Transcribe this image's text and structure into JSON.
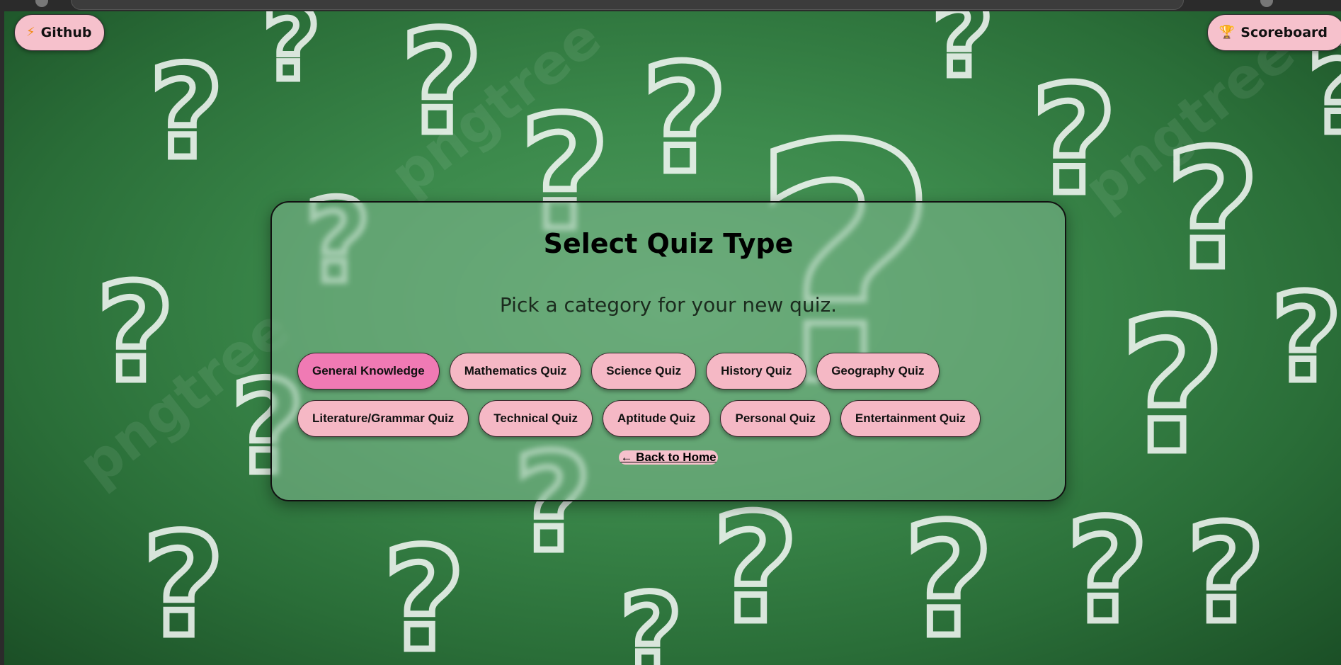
{
  "header": {
    "github_label": "Github",
    "github_icon": "lightning-icon",
    "scoreboard_label": "Scoreboard",
    "scoreboard_icon": "trophy-icon"
  },
  "background": {
    "watermark_text": "pngtree",
    "chalk_color": "#ffffff",
    "board_color": "#3c8a4c"
  },
  "panel": {
    "title": "Select Quiz Type",
    "subtitle": "Pick a category for your new quiz.",
    "quiz_types": [
      {
        "label": "General Knowledge",
        "active": true
      },
      {
        "label": "Mathematics Quiz",
        "active": false
      },
      {
        "label": "Science Quiz",
        "active": false
      },
      {
        "label": "History Quiz",
        "active": false
      },
      {
        "label": "Geography Quiz",
        "active": false
      },
      {
        "label": "Literature/Grammar Quiz",
        "active": false
      },
      {
        "label": "Technical Quiz",
        "active": false
      },
      {
        "label": "Aptitude Quiz",
        "active": false
      },
      {
        "label": "Personal Quiz",
        "active": false
      },
      {
        "label": "Entertainment Quiz",
        "active": false
      }
    ],
    "back_link": "← Back to Home"
  },
  "colors": {
    "button_pink": "#f5b8c5",
    "button_active": "#f07ab4",
    "panel_border": "#111111"
  }
}
